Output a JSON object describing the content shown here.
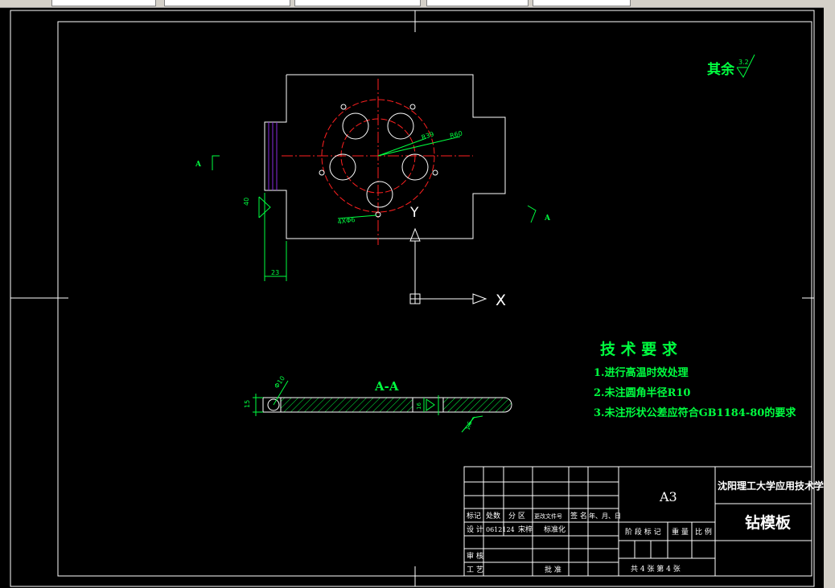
{
  "colors": {
    "background": "#000000",
    "frame": "#ffffff",
    "center_line": "#ff2020",
    "dimension": "#00ff40",
    "hatch": "#00ff40",
    "phantom": "#8a2be2",
    "ucs": "#ffffff",
    "ui_chrome": "#d4d0c8"
  },
  "drawing": {
    "roughness_note": "其余",
    "roughness_value": "3.2",
    "section_marker": "A",
    "section_title": "A-A",
    "ucs_x": "X",
    "ucs_y": "Y",
    "dims": {
      "r39": "R39",
      "r60": "R60",
      "holes": "4XΦ6",
      "width_23": "23",
      "dia_10": "Φ10",
      "thk_15": "15",
      "thk_16": "16",
      "finish_16": "1.6",
      "side_40": "40"
    }
  },
  "tech_requirements": {
    "title": "技 术 要 求",
    "items": [
      "1.进行高温时效处理",
      "2.未注圆角半径R10",
      "3.未注形状公差应符合GB1184-80的要求"
    ]
  },
  "title_block": {
    "headers": [
      "标记",
      "处数",
      "分 区",
      "更改文件号",
      "签 名",
      "年、月、日"
    ],
    "designer_label": "设 计",
    "designer_id": "0612124",
    "designer_name": "宋梓",
    "standard_label": "标准化",
    "review_label": "审 核",
    "process_label": "工 艺",
    "approve_label": "批 准",
    "paper_size": "A3",
    "stage_label": "阶 段 标 记",
    "weight_label": "重 量",
    "scale_label": "比 例",
    "sheet_count": "共 4  张   第  4 张",
    "school": "沈阳理工大学应用技术学院",
    "part_name": "钻模板"
  }
}
